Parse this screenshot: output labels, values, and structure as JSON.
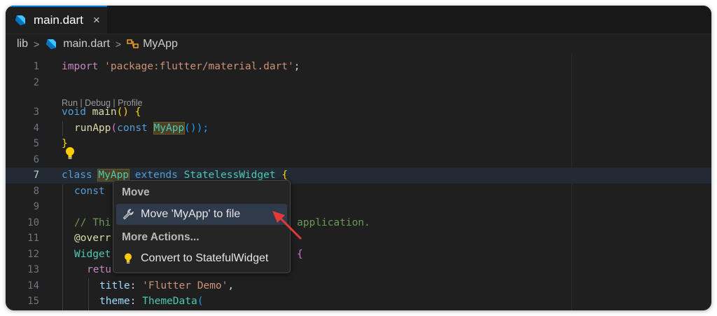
{
  "tab": {
    "label": "main.dart",
    "close": "×"
  },
  "breadcrumb": {
    "folder": "lib",
    "file": "main.dart",
    "symbol": "MyApp",
    "separator": ">"
  },
  "editor": {
    "line_numbers": [
      "1",
      "2",
      "3",
      "4",
      "5",
      "6",
      "7",
      "8",
      "9",
      "10",
      "11",
      "12",
      "13",
      "14",
      "15"
    ],
    "codelens": "Run | Debug | Profile",
    "code": {
      "l1_kw": "import",
      "l1_str": "'package:flutter/material.dart'",
      "l1_end": ";",
      "l3_kw": "void",
      "l3_fn": "main",
      "l3_rest": "() {",
      "l4_fn": "runApp",
      "l4_open": "(",
      "l4_kw": "const",
      "l4_cls": "MyApp",
      "l4_close": "());",
      "l5": "}",
      "l7_kw": "class",
      "l7_cls": "MyApp",
      "l7_kw2": "extends",
      "l7_cls2": "StatelessWidget",
      "l7_brace": "{",
      "l8_kw": "const",
      "l10_cmt1": "// Thi",
      "l10_cmt2": "application.",
      "l11_annot": "@overr",
      "l12_cls": "Widget",
      "l12_brace": "{",
      "l13_kw": "retu",
      "l14_prop": "title",
      "l14_colon": ": ",
      "l14_str": "'Flutter Demo'",
      "l14_end": ",",
      "l15_prop": "theme",
      "l15_colon": ": ",
      "l15_cls": "ThemeData",
      "l15_open": "("
    }
  },
  "popup": {
    "header_move": "Move",
    "item_move_file": "Move 'MyApp' to file",
    "header_more": "More Actions...",
    "item_convert": "Convert to StatefulWidget"
  },
  "colors": {
    "editor_bg": "#1f1f1f",
    "accent": "#0078d4",
    "arrow": "#e53935"
  },
  "icons": [
    "dart-icon",
    "close-icon",
    "chevron-right-icon",
    "class-symbol-icon",
    "lightbulb-icon",
    "wrench-icon"
  ]
}
